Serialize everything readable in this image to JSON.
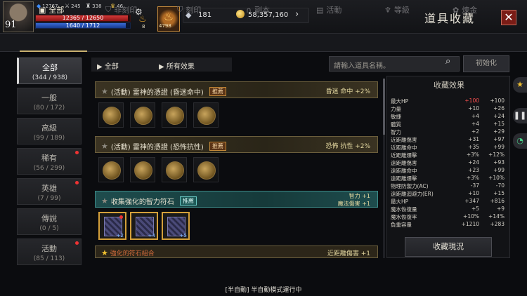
{
  "player": {
    "level": "91",
    "stat_blue": "12767",
    "stat_sword": "245",
    "stat_helm": "338",
    "stat_trophy": "46",
    "hp": "12365 / 12650",
    "hp_fraction": 0.977,
    "mp": "1640 / 1712",
    "mp_fraction": 0.958,
    "potion_count": "8",
    "slot_count": "4798"
  },
  "currency": {
    "gems": "181",
    "gold": "58,357,160"
  },
  "header": {
    "title": "道具收藏"
  },
  "tabs": [
    {
      "label": "全部",
      "icon": "book-icon",
      "active": true
    },
    {
      "label": "非刻印",
      "icon": "shield-icon"
    },
    {
      "label": "刻印",
      "icon": "shield-icon"
    },
    {
      "label": "副本",
      "icon": "horseshoe-icon"
    },
    {
      "label": "活動",
      "icon": "gift-icon"
    },
    {
      "label": "等級",
      "icon": "level-icon"
    },
    {
      "label": "煉金",
      "icon": "flower-icon"
    }
  ],
  "categories": [
    {
      "name": "全部",
      "count": "(344 / 938)",
      "active": true
    },
    {
      "name": "一般",
      "count": "(80 / 172)"
    },
    {
      "name": "高級",
      "count": "(99 / 189)"
    },
    {
      "name": "稀有",
      "count": "(56 / 299)",
      "dot": true
    },
    {
      "name": "英雄",
      "count": "(7 / 99)",
      "dot": true
    },
    {
      "name": "傳說",
      "count": "(0 / 5)"
    },
    {
      "name": "活動",
      "count": "(85 / 113)",
      "dot": true
    }
  ],
  "filters": {
    "left": "全部",
    "right": "所有效果"
  },
  "search": {
    "placeholder": "請輸入道具名稱。"
  },
  "reset_label": "初始化",
  "groups": [
    {
      "title": "(活動) 雷神的憑證 (昏迷命中)",
      "tag": "推薦",
      "effect": "昏迷 命中 +2%"
    },
    {
      "title": "(活動) 雷神的憑證 (恐怖抗性)",
      "tag": "推薦",
      "effect": "恐怖 抗性 +2%"
    },
    {
      "title": "收集強化的智力符石",
      "tag": "推薦",
      "effect1": "智力 +1",
      "effect2": "魔法傷害 +1",
      "counts": [
        "+2",
        "+4",
        "+5"
      ]
    },
    {
      "title": "強化的符石組合",
      "effect": "近距離傷害 +1"
    }
  ],
  "effects_panel": {
    "title": "收藏效果",
    "rows": [
      {
        "k": "最大HP",
        "v1": "+100",
        "v2": "+100",
        "red": true
      },
      {
        "k": "力量",
        "v1": "+10",
        "v2": "+26"
      },
      {
        "k": "敏捷",
        "v1": "+4",
        "v2": "+24"
      },
      {
        "k": "體質",
        "v1": "+4",
        "v2": "+15"
      },
      {
        "k": "智力",
        "v1": "+2",
        "v2": "+29"
      },
      {
        "k": "近距離傷害",
        "v1": "+31",
        "v2": "+97"
      },
      {
        "k": "近距離命中",
        "v1": "+35",
        "v2": "+99"
      },
      {
        "k": "近距離爆擊",
        "v1": "+3%",
        "v2": "+12%"
      },
      {
        "k": "遠距離傷害",
        "v1": "+24",
        "v2": "+93"
      },
      {
        "k": "遠距離命中",
        "v1": "+23",
        "v2": "+99"
      },
      {
        "k": "遠距離爆擊",
        "v1": "+3%",
        "v2": "+10%"
      },
      {
        "k": "物理防禦力(AC)",
        "v1": "-37",
        "v2": "-70"
      },
      {
        "k": "遠距離迴避力(ER)",
        "v1": "+10",
        "v2": "+15"
      },
      {
        "k": "最大HP",
        "v1": "+347",
        "v2": "+816"
      },
      {
        "k": "魔水恢復量",
        "v1": "+5",
        "v2": "+9"
      },
      {
        "k": "魔水恢復率",
        "v1": "+10%",
        "v2": "+14%"
      },
      {
        "k": "負重容量",
        "v1": "+1210",
        "v2": "+283"
      }
    ],
    "button": "收藏現況"
  },
  "status_text": "[半自動] 半自動模式運行中"
}
